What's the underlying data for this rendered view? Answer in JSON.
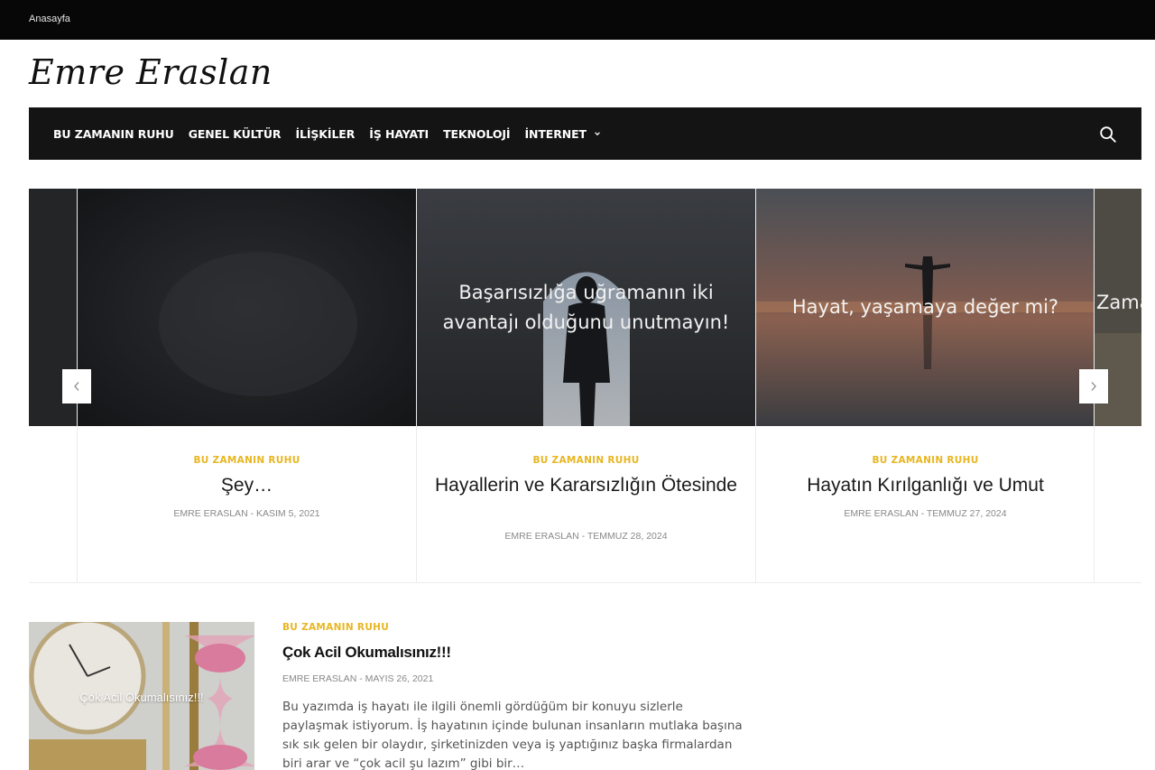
{
  "topbar": {
    "home_link": "Anasayfa"
  },
  "site": {
    "title": "Emre Eraslan"
  },
  "nav": {
    "items": [
      {
        "label": "BU ZAMANIN RUHU"
      },
      {
        "label": "GENEL KÜLTÜR"
      },
      {
        "label": "İLİŞKİLER"
      },
      {
        "label": "İŞ HAYATI"
      },
      {
        "label": "TEKNOLOJİ"
      },
      {
        "label": "İNTERNET"
      }
    ],
    "search_icon": "search-icon"
  },
  "slider": {
    "slides": [
      {
        "image_text": "",
        "category": "BU ZAMANIN RUHU",
        "title": "Şey…",
        "author": "EMRE ERASLAN",
        "date": "KASIM 5, 2021"
      },
      {
        "image_text": "Başarısızlığa uğramanın iki avantajı olduğunu unutmayın!",
        "category": "BU ZAMANIN RUHU",
        "title": "Hayallerin ve Kararsızlığın Ötesinde",
        "author": "EMRE ERASLAN",
        "date": "TEMMUZ 28, 2024"
      },
      {
        "image_text": "Hayat, yaşamaya değer mi?",
        "category": "BU ZAMANIN RUHU",
        "title": "Hayatın Kırılganlığı ve Umut",
        "author": "EMRE ERASLAN",
        "date": "TEMMUZ 27, 2024"
      }
    ],
    "next_slide_image_text": "Zama",
    "prev_icon": "chevron-left-icon",
    "next_icon": "chevron-right-icon",
    "meta_separator": "-"
  },
  "post": {
    "thumb_text": "Çok Acil Okumalısınız!!!",
    "category": "BU ZAMANIN RUHU",
    "title": "Çok Acil Okumalısınız!!!",
    "author": "EMRE ERASLAN",
    "date": "MAYIS 26, 2021",
    "excerpt": "Bu yazımda iş hayatı ile ilgili önemli gördüğüm bir konuyu sizlerle paylaşmak istiyorum. İş hayatının içinde bulunan insanların mutlaka başına sık sık gelen bir olaydır, şirketinizden veya iş yaptığınız başka firmalardan biri arar ve “çok acil şu lazım” gibi bir…"
  },
  "colors": {
    "accent": "#e8b622",
    "nav_bg": "#141414",
    "topbar_bg": "#070707"
  }
}
